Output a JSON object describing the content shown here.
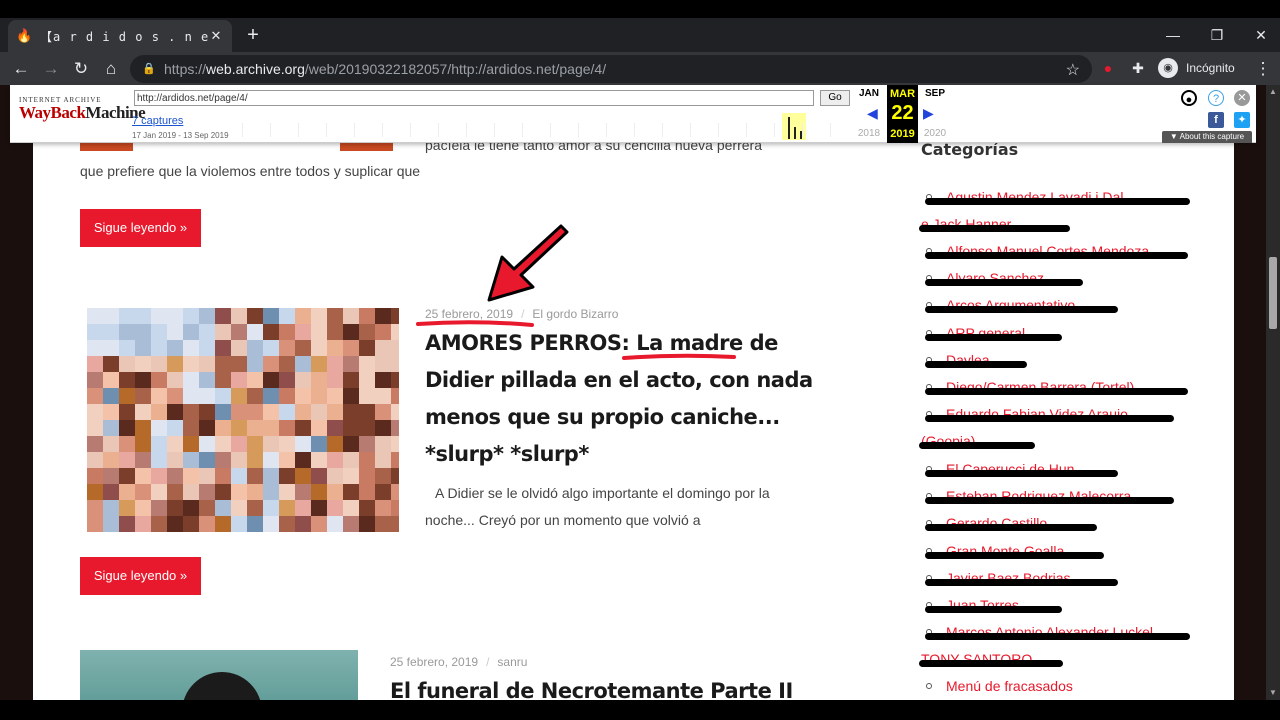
{
  "browser": {
    "tab_title": "【a r d i d o s . n e t】- Pág",
    "tab_favicon": "fire-icon",
    "new_tab_label": "+",
    "url_scheme": "https://",
    "url_host": "web.archive.org",
    "url_path": "/web/20190322182057/http://ardidos.net/page/4/",
    "incognito_label": "Incógnito"
  },
  "wayback": {
    "logo_top": "INTERNET ARCHIVE",
    "logo_a": "WayBack",
    "logo_b": "Machine",
    "url_value": "http://ardidos.net/page/4/",
    "go_label": "Go",
    "captures_label": "7 captures",
    "range_label": "17 Jan 2019 - 13 Sep 2019",
    "prev_month": "JAN",
    "cur_month": "MAR",
    "next_month": "SEP",
    "day": "22",
    "prev_year": "2018",
    "cur_year": "2019",
    "next_year": "2020",
    "about_label": "▼ About this capture"
  },
  "article_top": {
    "excerpt_fragment": "pacíela le tiene tanto amor a su cencilla nueva perrera",
    "excerpt_line": "que prefiere que la violemos entre todos y suplicar que",
    "readmore_label": "Sigue leyendo »"
  },
  "post1": {
    "date": "25 febrero, 2019",
    "author": "El gordo Bizarro",
    "title_l1": "AMORES PERROS: La madre de",
    "title_l2": "Didier pillada en el acto, con nada",
    "title_l3": "menos que su propio caniche...",
    "title_l4": "*slurp* *slurp*",
    "excerpt_l1": "A Didier se le olvidó algo importante el domingo por la",
    "excerpt_l2": "noche... Creyó por un momento que volvió a",
    "readmore_label": "Sigue leyendo »"
  },
  "post2": {
    "date": "25 febrero, 2019",
    "author": "sanru",
    "title": "El funeral de Necrotemante Parte II"
  },
  "sidebar": {
    "title": "Categorías",
    "items": [
      "Agustin Mendez Lavadi   i   Dal",
      "e Jack Hanner",
      "Alfonso Manuel Cortes Mendoza",
      "Alvaro Sanchez",
      "Arcos Argumentativo",
      "ARP general",
      "Daylea",
      "Diego/Carmen Barrera (Tortel)",
      "Eduardo Fabian Videz Araujo",
      "(Goopia)",
      "El Caperucci de Hun",
      "Esteban Rodriguez Malecorra",
      "Gerardo Castillo",
      "Gran Monte Goalla",
      "Javier Baez Bodrias",
      "Juan Torres",
      "Marcos Antonio Alexander Luckel",
      "TONY SANTORO",
      "Menú de fracasados"
    ]
  }
}
